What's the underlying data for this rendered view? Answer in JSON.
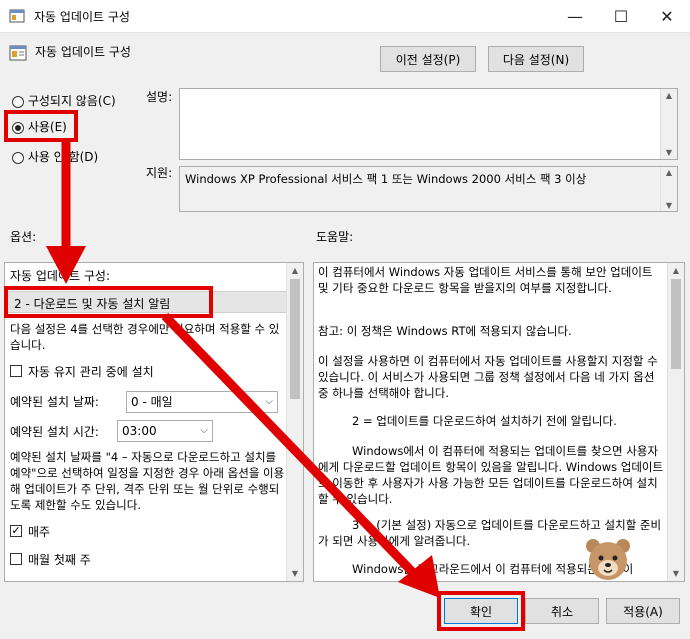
{
  "window": {
    "title": "자동 업데이트 구성"
  },
  "header": {
    "policy_name": "자동 업데이트 구성",
    "prev_button": "이전 설정(P)",
    "next_button": "다음 설정(N)"
  },
  "state": {
    "radios": [
      {
        "label": "구성되지 않음(C)",
        "checked": false
      },
      {
        "label": "사용(E)",
        "checked": true
      },
      {
        "label": "사용 안 함(D)",
        "checked": false
      }
    ],
    "comment_label": "설명:",
    "supported_label": "지원:",
    "supported_text": "Windows XP Professional 서비스 팩 1 또는 Windows 2000 서비스 팩 3 이상"
  },
  "options": {
    "section_label": "옵션:",
    "config_label": "자동 업데이트 구성:",
    "config_value": "2 - 다운로드 및 자동 설치 알림",
    "note": "다음 설정은 4를 선택한 경우에만 필요하며 적용할 수 있습니다.",
    "maintenance_checkbox": "자동 유지 관리 중에 설치",
    "day_label": "예약된 설치 날짜:",
    "day_value": "0 - 매일",
    "time_label": "예약된 설치 시간:",
    "time_value": "03:00",
    "long_note": "예약된 설치 날짜를 \"4 – 자동으로 다운로드하고 설치를 예약\"으로 선택하여 일정을 지정한 경우 아래 옵션을 이용해 업데이트가 주 단위, 격주 단위 또는 월 단위로 수행되도록 제한할 수도 있습니다.",
    "every_week": "매주",
    "first_week": "매월 첫째 주"
  },
  "help": {
    "section_label": "도움말:",
    "paragraphs": [
      "이 컴퓨터에서 Windows 자동 업데이트 서비스를 통해 보안 업데이트 및 기타 중요한 다운로드 항목을 받을지의 여부를 지정합니다.",
      "참고: 이 정책은 Windows RT에 적용되지 않습니다.",
      "이 설정을 사용하면 이 컴퓨터에서 자동 업데이트를 사용할지 지정할 수 있습니다. 이 서비스가 사용되면 그룹 정책 설정에서 다음 네 가지 옵션 중 하나를 선택해야 합니다.",
      "2 = 업데이트를 다운로드하여 설치하기 전에 알립니다.",
      "Windows에서 이 컴퓨터에 적용되는 업데이트를 찾으면 사용자에게 다운로드할 업데이트 항목이 있음을 알립니다. Windows 업데이트로 이동한 후 사용자가 사용 가능한 모든 업데이트를 다운로드하여 설치할 수 있습니다.",
      "3 = (기본 설정) 자동으로 업데이트를 다운로드하고 설치할 준비가 되면 사용자에게 알려줍니다.",
      "Windows는 백그라운드에서 이 컴퓨터에 적용되는 업데이"
    ]
  },
  "footer": {
    "ok": "확인",
    "cancel": "취소",
    "apply": "적용(A)"
  },
  "colors": {
    "annotation": "#e00000",
    "window_bg": "#f0f0f0"
  }
}
